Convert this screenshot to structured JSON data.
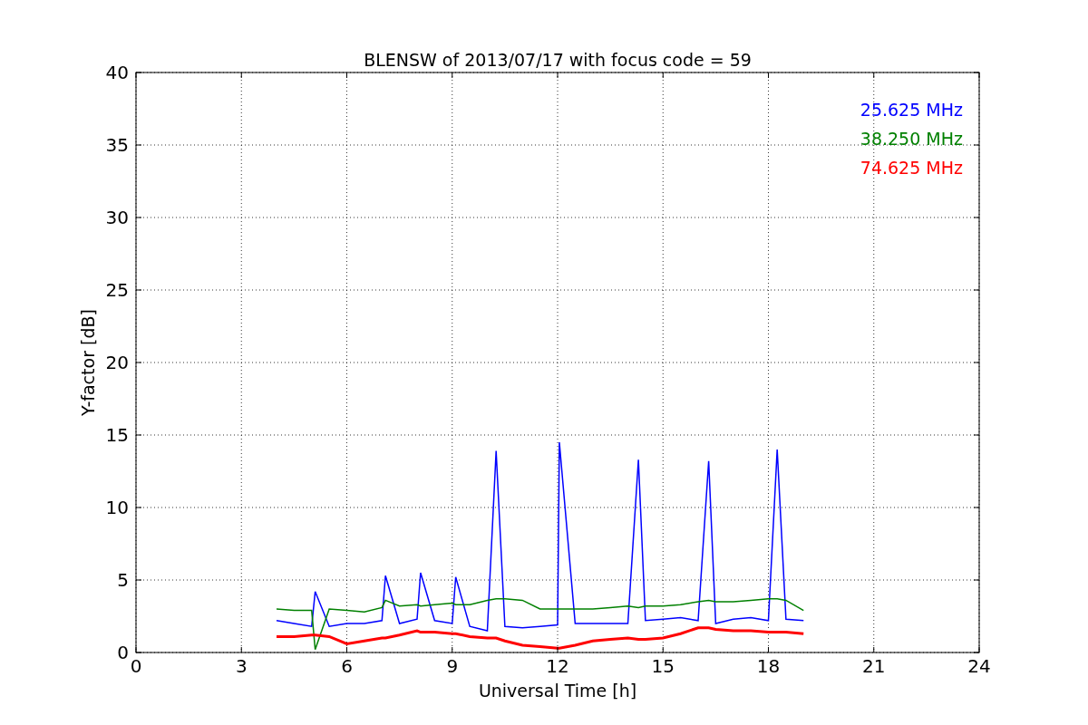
{
  "chart_data": {
    "type": "line",
    "title": "BLENSW of 2013/07/17 with focus code = 59",
    "xlabel": "Universal Time [h]",
    "ylabel": "Y-factor [dB]",
    "x": [
      4,
      4.5,
      5,
      5.1,
      5.5,
      6,
      6.5,
      7,
      7.1,
      7.5,
      8,
      8.1,
      8.5,
      9,
      9.1,
      9.5,
      10,
      10.25,
      10.5,
      11,
      11.5,
      12,
      12.05,
      12.5,
      13,
      13.5,
      14,
      14.3,
      14.5,
      15,
      15.5,
      16,
      16.3,
      16.5,
      17,
      17.5,
      18,
      18.25,
      18.5,
      19
    ],
    "series": [
      {
        "name": "25.625 MHz",
        "color": "#0000ff",
        "values": [
          2.2,
          2,
          1.8,
          4.2,
          1.8,
          2,
          2,
          2.2,
          5.3,
          2,
          2.3,
          5.5,
          2.2,
          2,
          5.2,
          1.8,
          1.5,
          13.9,
          1.8,
          1.7,
          1.8,
          1.9,
          14.5,
          2,
          2,
          2,
          2,
          13.3,
          2.2,
          2.3,
          2.4,
          2.2,
          13.2,
          2,
          2.3,
          2.4,
          2.2,
          14,
          2.3,
          2.2
        ]
      },
      {
        "name": "38.250 MHz",
        "color": "#008000",
        "values": [
          3,
          2.9,
          2.9,
          0.2,
          3,
          2.9,
          2.8,
          3.1,
          3.6,
          3.2,
          3.3,
          3.2,
          3.3,
          3.4,
          3.3,
          3.3,
          3.6,
          3.7,
          3.7,
          3.6,
          3,
          3,
          3,
          3,
          3,
          3.1,
          3.2,
          3.1,
          3.2,
          3.2,
          3.3,
          3.5,
          3.6,
          3.5,
          3.5,
          3.6,
          3.7,
          3.7,
          3.6,
          2.9
        ]
      },
      {
        "name": "74.625 MHz",
        "color": "#ff0000",
        "values": [
          1.1,
          1.1,
          1.2,
          1.2,
          1.1,
          0.6,
          0.8,
          1,
          1,
          1.2,
          1.5,
          1.4,
          1.4,
          1.3,
          1.3,
          1.1,
          1,
          1,
          0.8,
          0.5,
          0.4,
          0.3,
          0.3,
          0.5,
          0.8,
          0.9,
          1,
          0.9,
          0.9,
          1,
          1.3,
          1.7,
          1.7,
          1.6,
          1.5,
          1.5,
          1.4,
          1.4,
          1.4,
          1.3
        ]
      }
    ],
    "xlim": [
      0,
      24
    ],
    "ylim": [
      0,
      40
    ],
    "xticks": [
      0,
      3,
      6,
      9,
      12,
      15,
      18,
      21,
      24
    ],
    "yticks": [
      0,
      5,
      10,
      15,
      20,
      25,
      30,
      35,
      40
    ],
    "grid": true
  }
}
